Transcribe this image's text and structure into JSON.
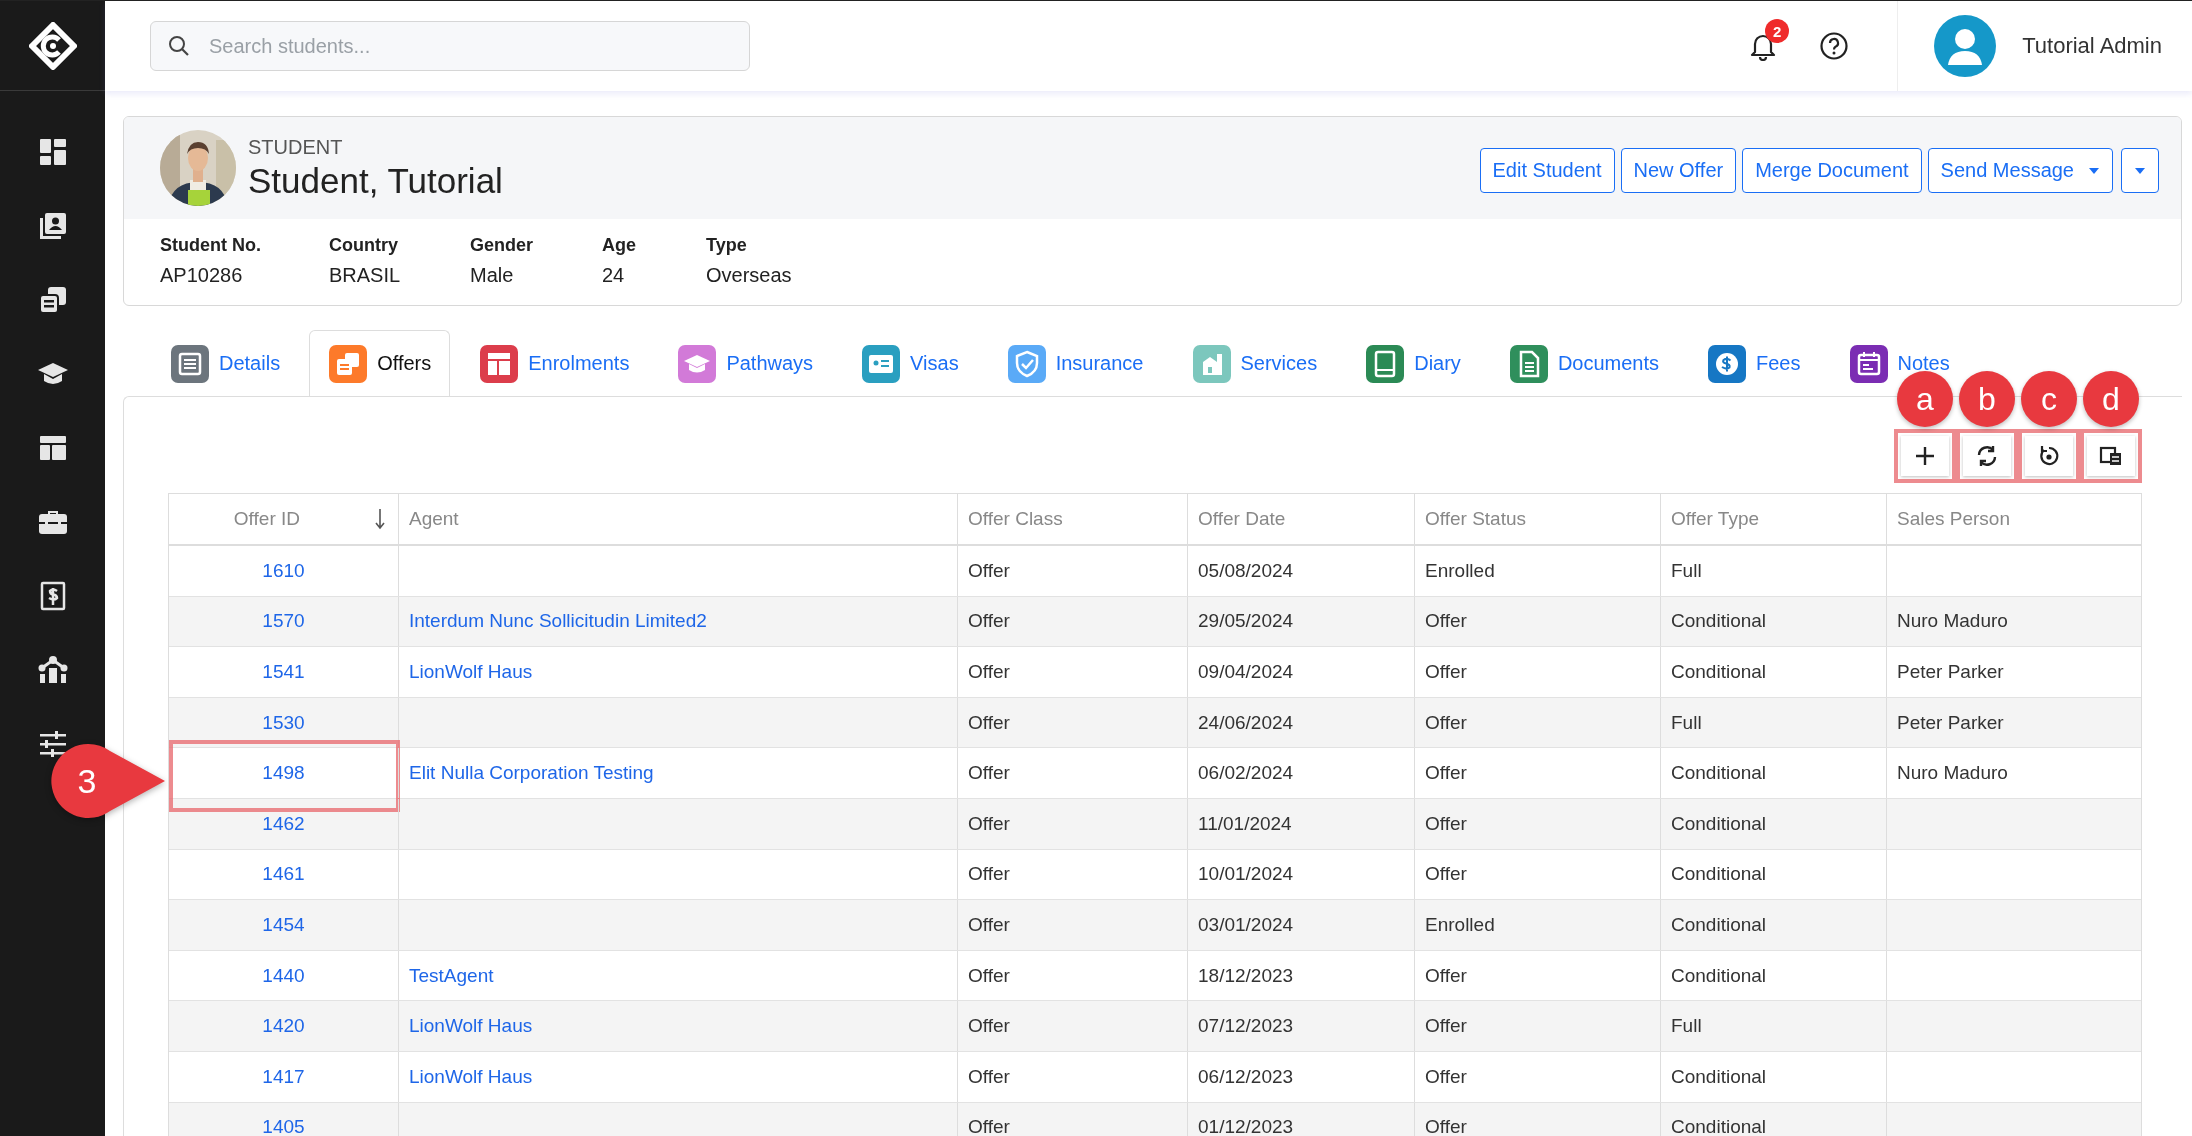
{
  "search": {
    "placeholder": "Search students..."
  },
  "notifications": {
    "count": "2"
  },
  "user": {
    "name": "Tutorial Admin"
  },
  "student": {
    "role": "STUDENT",
    "name": "Student, Tutorial",
    "fields": [
      {
        "label": "Student No.",
        "value": "AP10286"
      },
      {
        "label": "Country",
        "value": "BRASIL"
      },
      {
        "label": "Gender",
        "value": "Male"
      },
      {
        "label": "Age",
        "value": "24"
      },
      {
        "label": "Type",
        "value": "Overseas"
      }
    ]
  },
  "actions": [
    {
      "kind": "button",
      "label": "Edit Student"
    },
    {
      "kind": "button",
      "label": "New Offer"
    },
    {
      "kind": "button",
      "label": "Merge Document"
    },
    {
      "kind": "dropdown",
      "label": "Send Message"
    },
    {
      "kind": "caret"
    }
  ],
  "tabs": [
    {
      "label": "Details",
      "selected": false,
      "color": "#6c757d"
    },
    {
      "label": "Offers",
      "selected": true,
      "color": "#fd7a2a"
    },
    {
      "label": "Enrolments",
      "selected": false,
      "color": "#dc3d4b"
    },
    {
      "label": "Pathways",
      "selected": false,
      "color": "#d27ad8"
    },
    {
      "label": "Visas",
      "selected": false,
      "color": "#2a9fc0"
    },
    {
      "label": "Insurance",
      "selected": false,
      "color": "#5aaaf7"
    },
    {
      "label": "Services",
      "selected": false,
      "color": "#7cc7bd"
    },
    {
      "label": "Diary",
      "selected": false,
      "color": "#2b8a55"
    },
    {
      "label": "Documents",
      "selected": false,
      "color": "#2f8f5c"
    },
    {
      "label": "Fees",
      "selected": false,
      "color": "#1677c4"
    },
    {
      "label": "Notes",
      "selected": false,
      "color": "#7b2db3"
    }
  ],
  "toolbar": [
    {
      "kind": "add",
      "callout": "a"
    },
    {
      "kind": "refresh",
      "callout": "b"
    },
    {
      "kind": "reset",
      "callout": "c"
    },
    {
      "kind": "columns",
      "callout": "d"
    }
  ],
  "table": {
    "columns": [
      {
        "label": "Offer ID",
        "kind": "link",
        "sorted": true
      },
      {
        "label": "Agent",
        "kind": "link"
      },
      {
        "label": "Offer Class",
        "kind": "text"
      },
      {
        "label": "Offer Date",
        "kind": "text"
      },
      {
        "label": "Offer Status",
        "kind": "text"
      },
      {
        "label": "Offer Type",
        "kind": "text"
      },
      {
        "label": "Sales Person",
        "kind": "text"
      }
    ],
    "rows": [
      {
        "offer_id": "1610",
        "offer_class": "Offer",
        "offer_date": "05/08/2024",
        "offer_status": "Enrolled",
        "offer_type": "Full"
      },
      {
        "offer_id": "1570",
        "agent": "Interdum Nunc Sollicitudin Limited2",
        "offer_class": "Offer",
        "offer_date": "29/05/2024",
        "offer_status": "Offer",
        "offer_type": "Conditional",
        "sales_person": "Nuro Maduro"
      },
      {
        "offer_id": "1541",
        "agent": "LionWolf Haus",
        "offer_class": "Offer",
        "offer_date": "09/04/2024",
        "offer_status": "Offer",
        "offer_type": "Conditional",
        "sales_person": "Peter Parker"
      },
      {
        "offer_id": "1530",
        "offer_class": "Offer",
        "offer_date": "24/06/2024",
        "offer_status": "Offer",
        "offer_type": "Full",
        "sales_person": "Peter Parker"
      },
      {
        "offer_id": "1498",
        "agent": "Elit Nulla Corporation Testing",
        "offer_class": "Offer",
        "offer_date": "06/02/2024",
        "offer_status": "Offer",
        "offer_type": "Conditional",
        "sales_person": "Nuro Maduro",
        "highlighted": true,
        "callout": "3"
      },
      {
        "offer_id": "1462",
        "offer_class": "Offer",
        "offer_date": "11/01/2024",
        "offer_status": "Offer",
        "offer_type": "Conditional"
      },
      {
        "offer_id": "1461",
        "offer_class": "Offer",
        "offer_date": "10/01/2024",
        "offer_status": "Offer",
        "offer_type": "Conditional"
      },
      {
        "offer_id": "1454",
        "offer_class": "Offer",
        "offer_date": "03/01/2024",
        "offer_status": "Enrolled",
        "offer_type": "Conditional"
      },
      {
        "offer_id": "1440",
        "agent": "TestAgent",
        "offer_class": "Offer",
        "offer_date": "18/12/2023",
        "offer_status": "Offer",
        "offer_type": "Conditional"
      },
      {
        "offer_id": "1420",
        "agent": "LionWolf Haus",
        "offer_class": "Offer",
        "offer_date": "07/12/2023",
        "offer_status": "Offer",
        "offer_type": "Full"
      },
      {
        "offer_id": "1417",
        "agent": "LionWolf Haus",
        "offer_class": "Offer",
        "offer_date": "06/12/2023",
        "offer_status": "Offer",
        "offer_type": "Conditional"
      },
      {
        "offer_id": "1405",
        "offer_class": "Offer",
        "offer_date": "01/12/2023",
        "offer_status": "Offer",
        "offer_type": "Conditional"
      }
    ]
  }
}
